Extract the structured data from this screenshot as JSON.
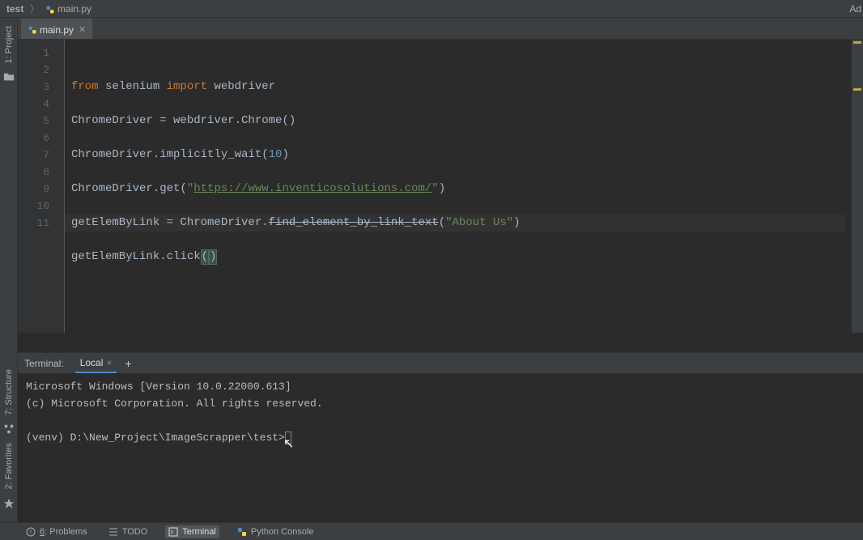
{
  "breadcrumb": {
    "project": "test",
    "file": "main.py"
  },
  "top_right": "Ad",
  "tab": {
    "file": "main.py"
  },
  "rail": {
    "project": "1: Project",
    "structure": "7: Structure",
    "favorites": "2: Favorites"
  },
  "code": {
    "lines": [
      "1",
      "2",
      "3",
      "4",
      "5",
      "6",
      "7",
      "8",
      "9",
      "10",
      "11"
    ],
    "l1_from": "from",
    "l1_mod": " selenium ",
    "l1_import": "import",
    "l1_name": " webdriver",
    "l3": "ChromeDriver = webdriver.Chrome()",
    "l5a": "ChromeDriver.implicitly_wait(",
    "l5num": "10",
    "l5b": ")",
    "l7a": "ChromeDriver.get(",
    "l7q": "\"",
    "l7url": "https://www.inventicosolutions.com/",
    "l7b": ")",
    "l9a": "getElemByLink = ChromeDriver.",
    "l9m": "find_element_by_link_text",
    "l9p": "(",
    "l9s": "\"About Us\"",
    "l9c": ")",
    "l11a": "getElemByLink.click",
    "l11p1": "(",
    "l11p2": ")"
  },
  "terminal": {
    "title": "Terminal:",
    "tab": "Local",
    "line1": "Microsoft Windows [Version 10.0.22000.613]",
    "line2": "(c) Microsoft Corporation. All rights reserved.",
    "prompt": "(venv) D:\\New_Project\\ImageScrapper\\test>"
  },
  "bottom": {
    "problems_key": "6",
    "problems": ": Problems",
    "todo": "TODO",
    "terminal": "Terminal",
    "pyconsole": "Python Console"
  }
}
